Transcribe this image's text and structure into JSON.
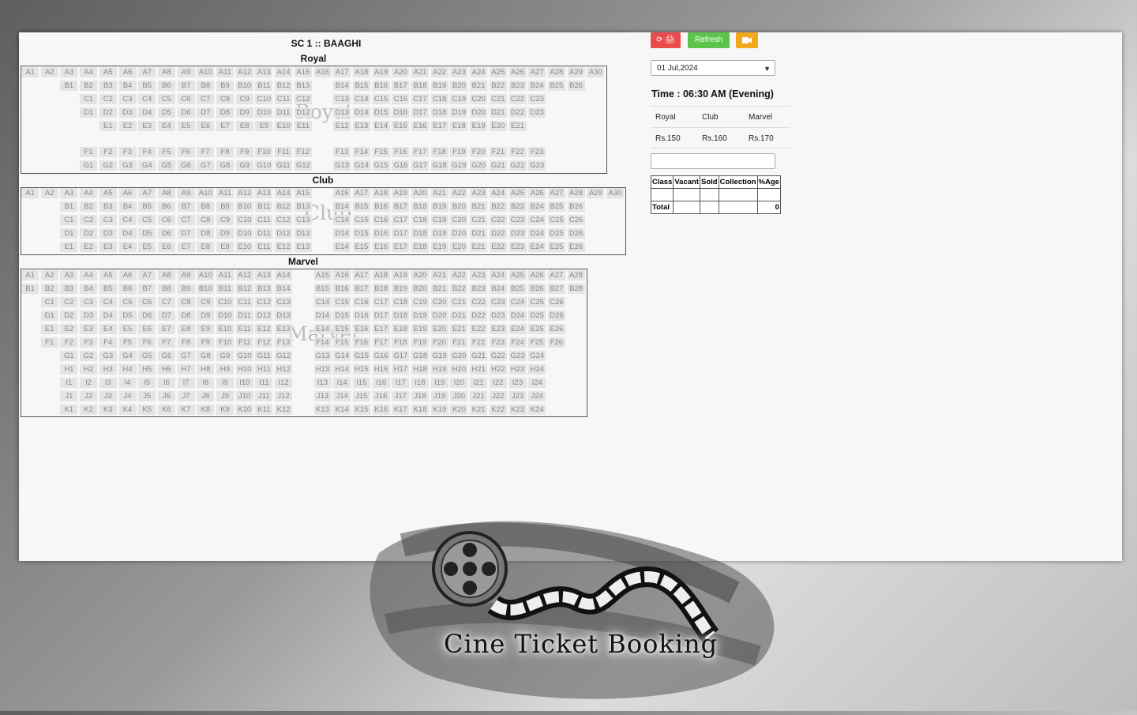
{
  "screen_title": "SC 1 :: BAAGHI",
  "classes": [
    {
      "name": "Royal",
      "watermark": "Royal"
    },
    {
      "name": "Club",
      "watermark": "Club"
    },
    {
      "name": "Marvel",
      "watermark": "Marvel"
    }
  ],
  "toolbar": {
    "print_label": "⟳ 🖨",
    "refresh_label": "Refresh",
    "camera_label": "■▸",
    "colors": {
      "print": "#e94b4b",
      "refresh": "#5cc44a",
      "camera": "#f0a91c"
    }
  },
  "date_select": {
    "value": "01 Jul,2024"
  },
  "show_time": "Time : 06:30 AM (Evening)",
  "rates": {
    "headers": [
      "Royal",
      "Club",
      "Marvel"
    ],
    "values": [
      "Rs.150",
      "Rs.160",
      "Rs.170"
    ]
  },
  "summary": {
    "headers": [
      "Class",
      "Vacant",
      "Sold",
      "Collection",
      "%Age"
    ],
    "total_label": "Total",
    "total_value": "0"
  },
  "logo": {
    "text": "Cine Ticket Booking"
  }
}
